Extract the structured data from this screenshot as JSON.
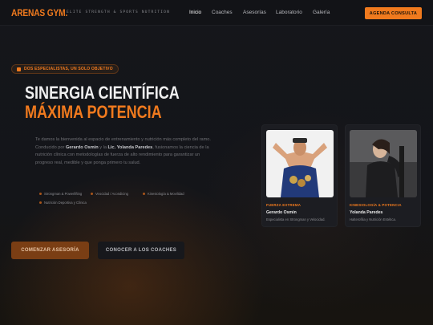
{
  "brand": {
    "name": "ARENAS GYM",
    "dot": ".",
    "tagline": "ELITE STRENGTH & SPORTS NUTRITION"
  },
  "nav": {
    "items": [
      {
        "label": "Inicio",
        "active": true
      },
      {
        "label": "Coaches",
        "active": false
      },
      {
        "label": "Asesorías",
        "active": false
      },
      {
        "label": "Laboratorio",
        "active": false
      },
      {
        "label": "Galería",
        "active": false
      }
    ],
    "cta_label": "AGENDA CONSULTA"
  },
  "hero": {
    "badge": "DOS ESPECIALISTAS, UN SOLO OBJETIVO",
    "title_line1": "SINERGIA CIENTÍFICA",
    "title_line2": "MÁXIMA POTENCIA",
    "para_pre": "Te damos la bienvenida al espacio de entrenamiento y nutrición más completo del ramo. Conducido por ",
    "coach1_bold": "Gerardo Osmin",
    "para_mid": " y la ",
    "coach2_bold": "Lic. Yolanda Paredes",
    "para_post": ", fusionamos la ciencia de la nutrición clínica con metodologías de fuerza de alto rendimiento para garantizar un progreso real, medible y que ponga primero tu salud.",
    "tags": [
      "Strongman & Powerlifting",
      "Veocidad / Acondicing",
      "Kinesiología & Movilidad",
      "Nutrición Deportiva y Clínica"
    ],
    "primary_button": "COMENZAR ASESORÍA",
    "secondary_button": "CONOCER A LOS COACHES"
  },
  "coaches": [
    {
      "tag": "FUERZA EXTREMA",
      "name": "Gerardo Osmin",
      "desc": "Especialista en Strongman y Velocidad."
    },
    {
      "tag": "KINESIOLOGÍA & POTENCIA",
      "name": "Yolanda Paredes",
      "desc": "Halterofilia y Nutrición Estética."
    }
  ],
  "colors": {
    "accent": "#f07a1e",
    "background": "#131418",
    "card": "#1c1d22"
  }
}
